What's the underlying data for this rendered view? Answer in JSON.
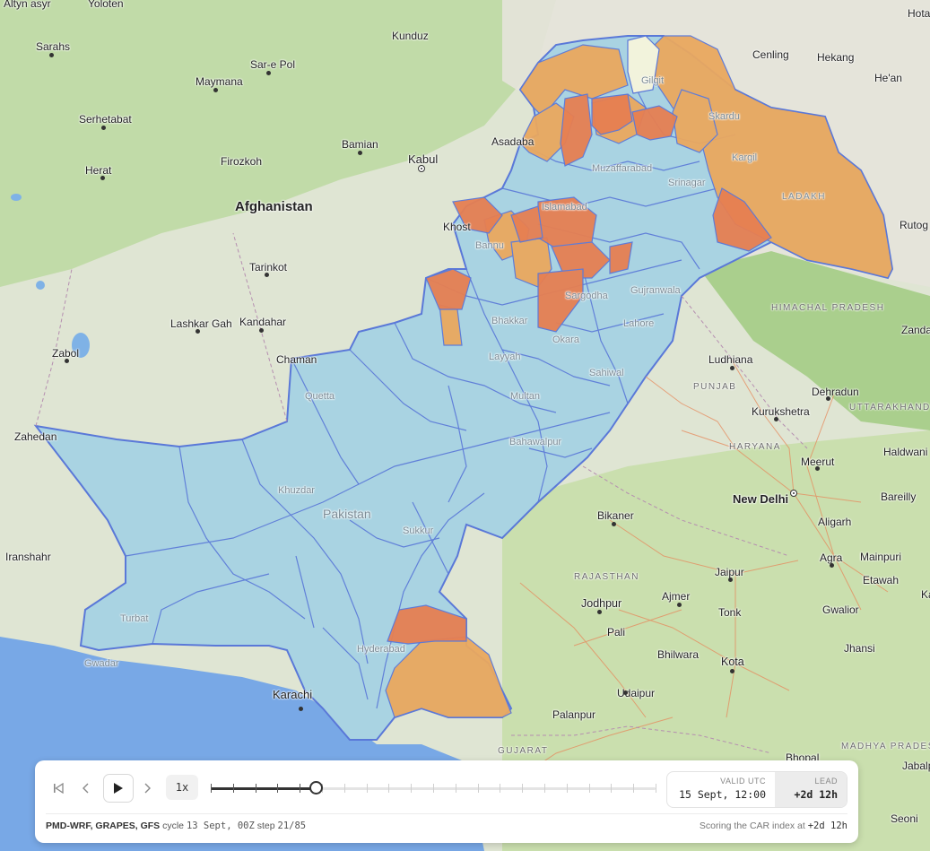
{
  "map": {
    "country_label": "Pakistan",
    "places": [
      {
        "name": "Altyn asyr",
        "kind": "city"
      },
      {
        "name": "Yoloten",
        "kind": "city"
      },
      {
        "name": "Kunduz",
        "kind": "city"
      },
      {
        "name": "Sarahs",
        "kind": "city"
      },
      {
        "name": "Sar-e Pol",
        "kind": "city"
      },
      {
        "name": "Maymana",
        "kind": "city"
      },
      {
        "name": "Serhetabat",
        "kind": "city"
      },
      {
        "name": "Bamian",
        "kind": "city"
      },
      {
        "name": "Kabul",
        "kind": "capital"
      },
      {
        "name": "Asadaba",
        "kind": "city"
      },
      {
        "name": "Herat",
        "kind": "city"
      },
      {
        "name": "Firozkoh",
        "kind": "city"
      },
      {
        "name": "Afghanistan",
        "kind": "country"
      },
      {
        "name": "Khost",
        "kind": "city"
      },
      {
        "name": "Tarinkot",
        "kind": "city"
      },
      {
        "name": "Lashkar Gah",
        "kind": "city"
      },
      {
        "name": "Kandahar",
        "kind": "city"
      },
      {
        "name": "Zabol",
        "kind": "city"
      },
      {
        "name": "Chaman",
        "kind": "city"
      },
      {
        "name": "Zahedan",
        "kind": "city"
      },
      {
        "name": "Iranshahr",
        "kind": "city"
      },
      {
        "name": "Karachi",
        "kind": "city"
      },
      {
        "name": "Turbat",
        "kind": "faint"
      },
      {
        "name": "Gwadar",
        "kind": "faint"
      },
      {
        "name": "Hyderabad",
        "kind": "faint"
      },
      {
        "name": "Sukkur",
        "kind": "faint"
      },
      {
        "name": "Quetta",
        "kind": "faint"
      },
      {
        "name": "Multan",
        "kind": "faint"
      },
      {
        "name": "Bahawalpur",
        "kind": "faint"
      },
      {
        "name": "Layyah",
        "kind": "faint"
      },
      {
        "name": "Bhakkar",
        "kind": "faint"
      },
      {
        "name": "Sargodha",
        "kind": "faint"
      },
      {
        "name": "Gujranwala",
        "kind": "faint"
      },
      {
        "name": "Lahore",
        "kind": "faint"
      },
      {
        "name": "Islamabad",
        "kind": "faint"
      },
      {
        "name": "Muzaffarabad",
        "kind": "faint"
      },
      {
        "name": "Bannu",
        "kind": "faint"
      },
      {
        "name": "Okara",
        "kind": "faint"
      },
      {
        "name": "Sahiwal",
        "kind": "faint"
      },
      {
        "name": "Khuzdar",
        "kind": "faint"
      },
      {
        "name": "Gilgit",
        "kind": "faint"
      },
      {
        "name": "Skardu",
        "kind": "faint"
      },
      {
        "name": "Kargil",
        "kind": "faint"
      },
      {
        "name": "Srinagar",
        "kind": "faint"
      },
      {
        "name": "LADAKH",
        "kind": "region-faint"
      },
      {
        "name": "Hotan",
        "kind": "city"
      },
      {
        "name": "Cenling",
        "kind": "city"
      },
      {
        "name": "Hekang",
        "kind": "city"
      },
      {
        "name": "He'an",
        "kind": "city"
      },
      {
        "name": "Rutog",
        "kind": "city"
      },
      {
        "name": "Zanda",
        "kind": "city"
      },
      {
        "name": "HIMACHAL PRADESH",
        "kind": "region"
      },
      {
        "name": "Ludhiana",
        "kind": "city"
      },
      {
        "name": "PUNJAB",
        "kind": "region"
      },
      {
        "name": "Dehradun",
        "kind": "city"
      },
      {
        "name": "UTTARAKHAND",
        "kind": "region"
      },
      {
        "name": "Kurukshetra",
        "kind": "city"
      },
      {
        "name": "HARYANA",
        "kind": "region"
      },
      {
        "name": "Haldwani",
        "kind": "city"
      },
      {
        "name": "Meerut",
        "kind": "city"
      },
      {
        "name": "New Delhi",
        "kind": "capital-big"
      },
      {
        "name": "Bareilly",
        "kind": "city"
      },
      {
        "name": "Aligarh",
        "kind": "city"
      },
      {
        "name": "Bikaner",
        "kind": "city"
      },
      {
        "name": "Agra",
        "kind": "city"
      },
      {
        "name": "Mainpuri",
        "kind": "city"
      },
      {
        "name": "RAJASTHAN",
        "kind": "region"
      },
      {
        "name": "Jaipur",
        "kind": "city"
      },
      {
        "name": "Etawah",
        "kind": "city"
      },
      {
        "name": "Jodhpur",
        "kind": "city"
      },
      {
        "name": "Ajmer",
        "kind": "city"
      },
      {
        "name": "Gwalior",
        "kind": "city"
      },
      {
        "name": "Tonk",
        "kind": "city"
      },
      {
        "name": "Pali",
        "kind": "city"
      },
      {
        "name": "Bhilwara",
        "kind": "city"
      },
      {
        "name": "Jhansi",
        "kind": "city"
      },
      {
        "name": "Kota",
        "kind": "city"
      },
      {
        "name": "Udaipur",
        "kind": "city"
      },
      {
        "name": "Palanpur",
        "kind": "city"
      },
      {
        "name": "GUJARAT",
        "kind": "region"
      },
      {
        "name": "Bhopal",
        "kind": "city"
      },
      {
        "name": "MADHYA PRADESH",
        "kind": "region"
      },
      {
        "name": "Jabalpur",
        "kind": "city"
      },
      {
        "name": "Seoni",
        "kind": "city"
      },
      {
        "name": "Ka",
        "kind": "city"
      },
      {
        "name": "Hotar",
        "kind": "city"
      }
    ],
    "colors": {
      "district_low": "#a9d3e2",
      "district_moderate": "#eaa85f",
      "district_high": "#e67f52",
      "district_border": "#5a78d8",
      "sea": "#78a8e6",
      "land_plain": "#dfe5d3",
      "land_green": "#b7d89a"
    }
  },
  "player": {
    "first_icon": "skip-to-start-icon",
    "prev_icon": "chevron-left-icon",
    "play_icon": "play-icon",
    "next_icon": "chevron-right-icon",
    "speed": "1x",
    "step_current": 21,
    "step_total": 85,
    "valid_utc_caption": "VALID UTC",
    "valid_utc_value": "15 Sept, 12:00",
    "lead_caption": "LEAD",
    "lead_value": "+2d 12h"
  },
  "footer": {
    "models": "PMD-WRF, GRAPES, GFS",
    "cycle_word": "cycle",
    "cycle_value": "13 Sept, 00Z",
    "step_word": "step",
    "step_value": "21/85",
    "scoring_text": "Scoring the CAR index at",
    "scoring_value": "+2d 12h"
  }
}
